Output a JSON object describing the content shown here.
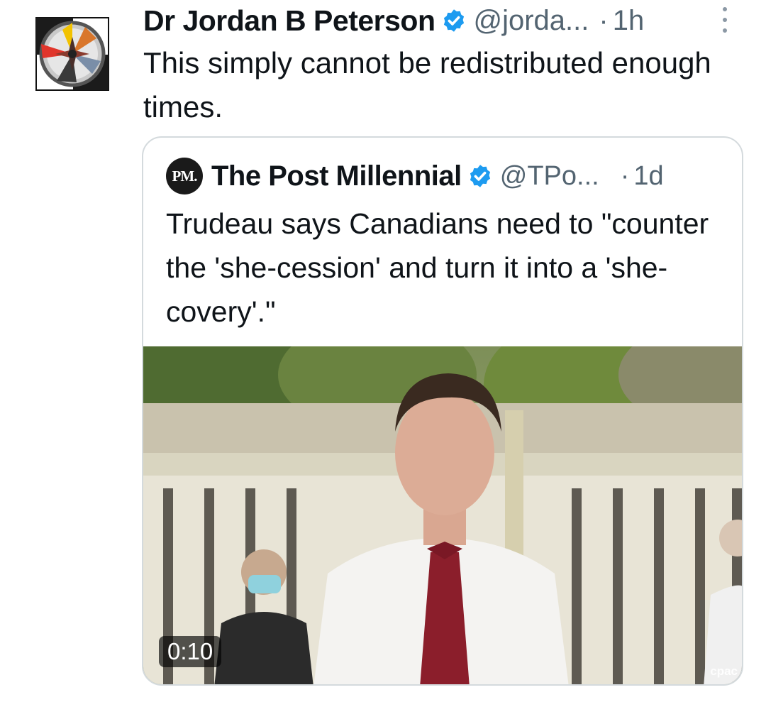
{
  "tweet": {
    "author_name": "Dr Jordan B Peterson",
    "handle": "@jorda...",
    "separator": "·",
    "time": "1h",
    "text": "This simply cannot be redistributed enough times.",
    "verified_color": "#1d9bf0",
    "avatar_icon": "compass-emblem-icon",
    "more_icon": "more-vertical-icon"
  },
  "quoted_tweet": {
    "logo_text": "PM.",
    "author_name": "The Post Millennial",
    "handle": "@TPo...",
    "separator": "·",
    "time": "1d",
    "text": "Trudeau says Canadians need to \"counter the 'she-cession' and turn it into a 'she-covery'.\"",
    "media": {
      "type": "video",
      "duration": "0:10",
      "watermark": "cpac"
    }
  }
}
